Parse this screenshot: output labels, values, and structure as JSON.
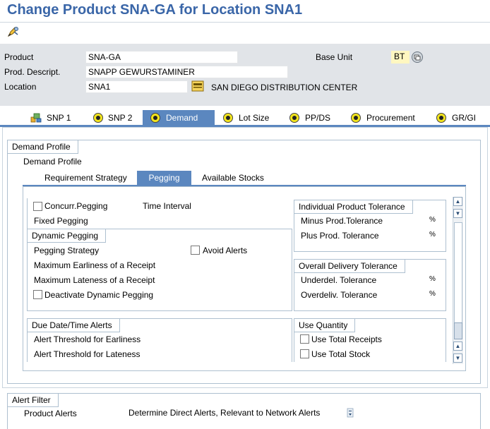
{
  "window": {
    "title": "Change Product SNA-GA for Location SNA1"
  },
  "toolbar": {
    "edit_icon": "display-change-icon"
  },
  "header": {
    "product_label": "Product",
    "product_value": "SNA-GA",
    "descr_label": "Prod. Descript.",
    "descr_value": "SNAPP GEWURSTAMINER",
    "location_label": "Location",
    "location_value": "SNA1",
    "location_text": "SAN DIEGO DISTRIBUTION CENTER",
    "base_unit_label": "Base Unit",
    "base_unit_value": "BT"
  },
  "tabs": [
    {
      "label": "SNP 1",
      "icon": "snp-chart-icon"
    },
    {
      "label": "SNP 2",
      "icon": "radio-icon"
    },
    {
      "label": "Demand",
      "icon": "radio-icon",
      "active": true
    },
    {
      "label": "Lot Size",
      "icon": "radio-icon"
    },
    {
      "label": "PP/DS",
      "icon": "radio-icon"
    },
    {
      "label": "Procurement",
      "icon": "radio-icon"
    },
    {
      "label": "GR/GI",
      "icon": "radio-icon"
    }
  ],
  "demand_profile": {
    "group_title": "Demand Profile",
    "label": "Demand Profile",
    "subtabs": [
      "Requirement Strategy",
      "Pegging",
      "Available Stocks"
    ],
    "active_subtab": "Pegging"
  },
  "pegging": {
    "concurr_pegging": "Concurr.Pegging",
    "time_interval": "Time Interval",
    "fixed_pegging": "Fixed Pegging",
    "dynamic_title": "Dynamic Pegging",
    "pegging_strategy": "Pegging Strategy",
    "avoid_alerts": "Avoid Alerts",
    "max_earliness": "Maximum Earliness of a Receipt",
    "max_lateness": "Maximum Lateness of a Receipt",
    "deactivate_dynamic": "Deactivate Dynamic Pegging",
    "ipt_title": "Individual Product Tolerance",
    "minus_tol": "Minus Prod.Tolerance",
    "plus_tol": "Plus Prod. Tolerance",
    "percent": "%",
    "odt_title": "Overall Delivery Tolerance",
    "underdel": "Underdel. Tolerance",
    "overdeliv": "Overdeliv. Tolerance",
    "due_title": "Due Date/Time Alerts",
    "alert_early": "Alert Threshold for Earliness",
    "alert_late": "Alert Threshold for Lateness",
    "use_qty_title": "Use Quantity",
    "use_total_receipts": "Use Total Receipts",
    "use_total_stock": "Use Total Stock"
  },
  "alert_filter": {
    "title": "Alert Filter",
    "product_alerts_label": "Product Alerts",
    "product_alerts_value": "Determine Direct Alerts, Relevant to Network Alerts"
  },
  "colors": {
    "title": "#3a66a8",
    "active_tab": "#5b87bf",
    "header_bg": "#e1e4e8",
    "key_field": "#fff7c0"
  }
}
